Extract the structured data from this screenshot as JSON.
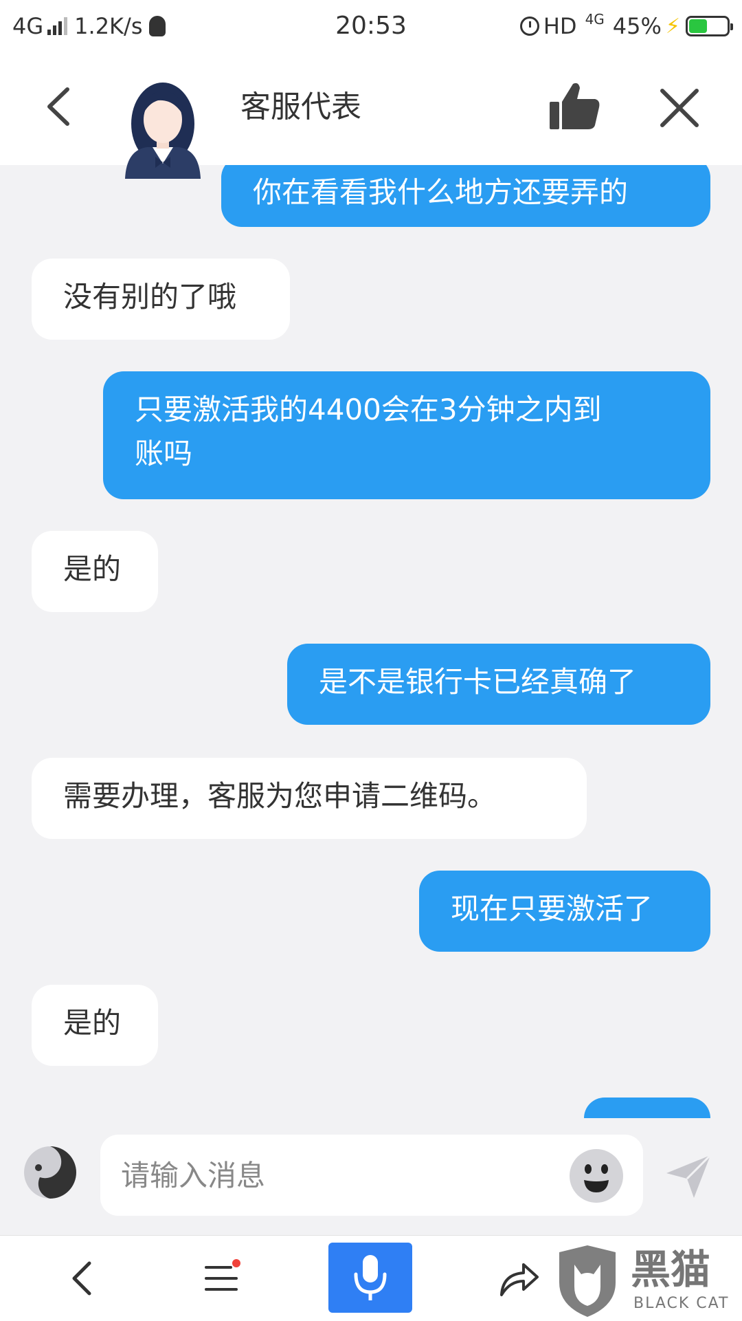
{
  "status_bar": {
    "network": "4G",
    "speed": "1.2K/s",
    "time": "20:53",
    "hd": "HD",
    "network_type": "4G",
    "battery": "45%"
  },
  "header": {
    "title": "客服代表"
  },
  "messages": [
    {
      "side": "out",
      "text": "你在看看我什么地方还要弄的"
    },
    {
      "side": "in",
      "text": "没有别的了哦"
    },
    {
      "side": "out",
      "text": "只要激活我的4400会在3分钟之内到\n账吗"
    },
    {
      "side": "in",
      "text": "是的"
    },
    {
      "side": "out",
      "text": "是不是银行卡已经真确了"
    },
    {
      "side": "in",
      "text": "需要办理，客服为您申请二维码。"
    },
    {
      "side": "out",
      "text": "现在只要激活了"
    },
    {
      "side": "in",
      "text": "是的"
    }
  ],
  "input": {
    "placeholder": "请输入消息"
  },
  "watermark": {
    "cn": "黑猫",
    "en": "BLACK CAT"
  },
  "colors": {
    "outgoing_bubble": "#2a9df2",
    "incoming_bubble": "#ffffff",
    "background": "#f2f2f4",
    "mic_button": "#2f7ff4",
    "battery_fill": "#2ac640"
  },
  "icons": {
    "back": "chevron-left-icon",
    "like": "thumbs-up-icon",
    "close": "close-icon",
    "voice": "voice-toggle-icon",
    "emoji": "emoji-icon",
    "send": "send-icon",
    "nav_menu": "menu-icon",
    "nav_mic": "mic-icon",
    "nav_share": "share-icon"
  }
}
